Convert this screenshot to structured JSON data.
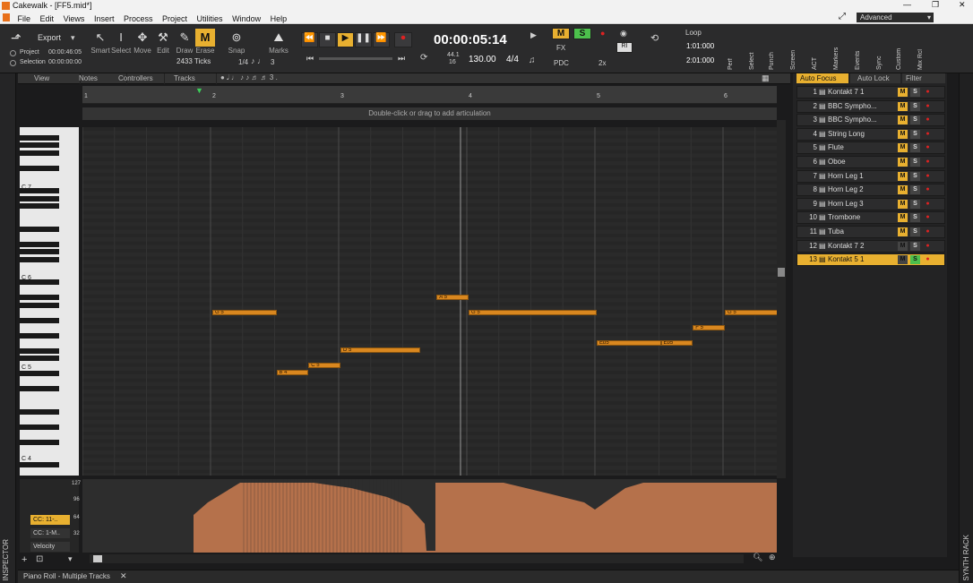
{
  "window": {
    "title": "Cakewalk - [FF5.mid*]"
  },
  "menu": [
    "File",
    "Edit",
    "Views",
    "Insert",
    "Process",
    "Project",
    "Utilities",
    "Window",
    "Help"
  ],
  "workspace": "Advanced",
  "controlbar": {
    "export_label": "Export",
    "project_label": "Project",
    "project_time": "00:00:46:05",
    "selection_label": "Selection",
    "selection_time": "00:00:00:00",
    "tools": [
      "Smart",
      "Select",
      "Move",
      "Edit",
      "Draw",
      "Erase"
    ],
    "snap_label": "Snap",
    "marks_label": "Marks",
    "ticks": "2433 Ticks",
    "snap_fraction": "1/4",
    "snap_count": "3",
    "time": "00:00:05:14",
    "sample_rate_top": "44.1",
    "sample_rate_bottom": "16",
    "tempo": "130.00",
    "meter": "4/4",
    "loop_label": "Loop",
    "loop_start": "1:01:000",
    "loop_end": "2:01:000",
    "fx_label": "FX",
    "pdc_label": "PDC",
    "speed_label": "2x",
    "modules": [
      "Perf",
      "Select",
      "Punch",
      "Screen",
      "ACT",
      "Markers",
      "Events",
      "Sync",
      "Custom",
      "Mix Rcl"
    ]
  },
  "pianoroll": {
    "menus": [
      "View",
      "Notes",
      "Controllers",
      "Tracks"
    ],
    "ruler_marks": [
      "1",
      "2",
      "3",
      "4",
      "5",
      "6"
    ],
    "articulation_hint": "Double-click or drag to add articulation",
    "octave_labels": [
      "C 7",
      "C 6",
      "C 5",
      "C 4"
    ],
    "notes": [
      {
        "label": "G 5",
        "start": 2.0,
        "end": 2.5,
        "pitch": 79
      },
      {
        "label": "A 5",
        "start": 3.75,
        "end": 4.0,
        "pitch": 81
      },
      {
        "label": "G 5",
        "start": 4.0,
        "end": 5.0,
        "pitch": 79
      },
      {
        "label": "B 4",
        "start": 2.5,
        "end": 2.75,
        "pitch": 71
      },
      {
        "label": "C 5",
        "start": 2.75,
        "end": 3.0,
        "pitch": 72
      },
      {
        "label": "D 5",
        "start": 3.0,
        "end": 3.625,
        "pitch": 74
      },
      {
        "label": "Eb5",
        "start": 5.0,
        "end": 5.5,
        "pitch": 75
      },
      {
        "label": "Eb5",
        "start": 5.5,
        "end": 5.75,
        "pitch": 75
      },
      {
        "label": "F 5",
        "start": 5.75,
        "end": 6.0,
        "pitch": 77
      },
      {
        "label": "G 5",
        "start": 6.0,
        "end": 6.5,
        "pitch": 79
      }
    ],
    "controller_lanes": [
      "CC: 11-..",
      "CC: 1-M..",
      "Velocity"
    ],
    "controller_scale": [
      "127",
      "96",
      "64",
      "32"
    ]
  },
  "tracks": {
    "tabs": [
      "Auto Focus",
      "Auto Lock",
      "Filter"
    ],
    "list": [
      {
        "num": "1",
        "name": "Kontakt 7 1"
      },
      {
        "num": "2",
        "name": "BBC Sympho..."
      },
      {
        "num": "3",
        "name": "BBC Sympho..."
      },
      {
        "num": "4",
        "name": "String Long"
      },
      {
        "num": "5",
        "name": "Flute"
      },
      {
        "num": "6",
        "name": "Oboe"
      },
      {
        "num": "7",
        "name": "Horn Leg 1"
      },
      {
        "num": "8",
        "name": "Horn Leg 2"
      },
      {
        "num": "9",
        "name": "Horn Leg 3"
      },
      {
        "num": "10",
        "name": "Trombone"
      },
      {
        "num": "11",
        "name": "Tuba"
      },
      {
        "num": "12",
        "name": "Kontakt 7 2"
      },
      {
        "num": "13",
        "name": "Kontakt 5 1"
      }
    ]
  },
  "sidebar": {
    "inspector": "INSPECTOR",
    "synth_rack": "SYNTH RACK"
  },
  "status": {
    "tab": "Piano Roll - Multiple Tracks"
  },
  "colors": {
    "note": "#d9871f",
    "accent": "#e8b030",
    "solo": "#4cc04c",
    "record": "#dd2222"
  }
}
